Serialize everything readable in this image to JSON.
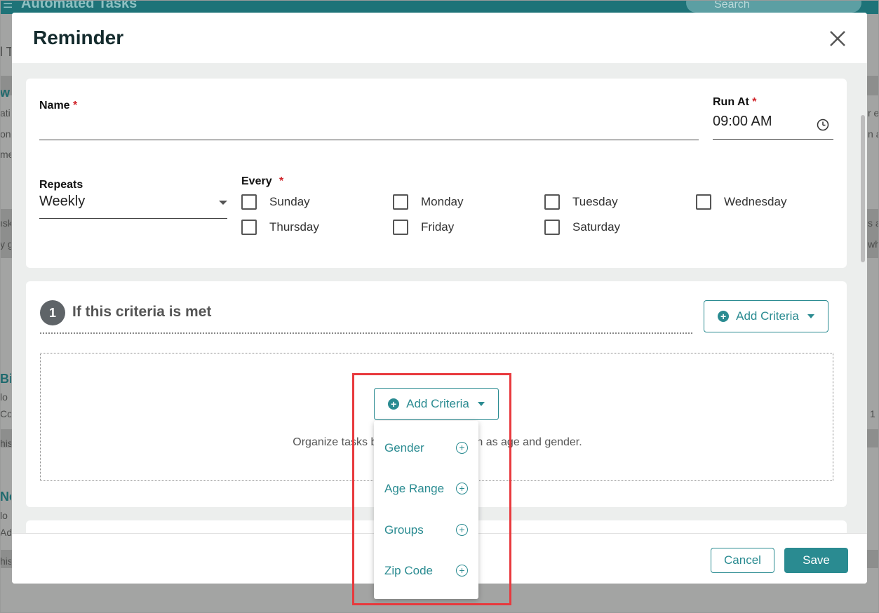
{
  "background": {
    "app_title": "Automated Tasks",
    "search_placeholder": "Search",
    "left_snippets": [
      "l T",
      "w",
      "ati",
      "one",
      "me",
      "ısk",
      "y g",
      "Bir",
      "lo",
      "Cor",
      "his",
      "Ne",
      "lo",
      "Ado",
      "his"
    ],
    "right_snippets": [
      "r e",
      "n a",
      "s a",
      "wh",
      "1"
    ]
  },
  "modal": {
    "title": "Reminder",
    "close_icon": "close-icon",
    "name_label": "Name",
    "name_value": "",
    "run_at_label": "Run At",
    "run_at_value": "09:00 AM",
    "required_mark": "*",
    "repeats_label": "Repeats",
    "repeats_value": "Weekly",
    "every_label": "Every",
    "days": [
      "Sunday",
      "Monday",
      "Tuesday",
      "Wednesday",
      "Thursday",
      "Friday",
      "Saturday"
    ],
    "criteria_step": "1",
    "criteria_title": "If this criteria is met",
    "add_criteria_label": "Add Criteria",
    "drop_text_left": "Organize tasks b",
    "drop_text_right": "n as age and gender.",
    "dropdown_items": [
      "Gender",
      "Age Range",
      "Groups",
      "Zip Code"
    ],
    "cancel_label": "Cancel",
    "save_label": "Save"
  },
  "colors": {
    "accent": "#2a8b91",
    "required": "#d0252b",
    "highlight": "#e8393d"
  }
}
